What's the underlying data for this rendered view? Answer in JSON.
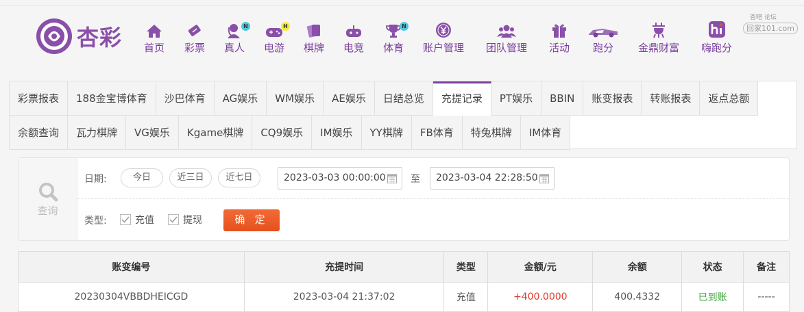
{
  "brand": {
    "name": "杏彩",
    "accent": "#7b3f9e"
  },
  "nav": [
    {
      "label": "首页",
      "icon": "home-icon"
    },
    {
      "label": "彩票",
      "icon": "lottery-ticket-icon"
    },
    {
      "label": "真人",
      "icon": "live-dealer-icon",
      "badge": "N"
    },
    {
      "label": "电游",
      "icon": "gamepad-icon",
      "badge": "H"
    },
    {
      "label": "棋牌",
      "icon": "cards-icon"
    },
    {
      "label": "电竞",
      "icon": "joystick-icon"
    },
    {
      "label": "体育",
      "icon": "trophy-icon",
      "badge": "N"
    },
    {
      "label": "账户管理",
      "icon": "yen-coin-icon"
    },
    {
      "label": "团队管理",
      "icon": "team-icon"
    },
    {
      "label": "活动",
      "icon": "gift-icon"
    },
    {
      "label": "跑分",
      "icon": "race-car-icon"
    },
    {
      "label": "金鼎财富",
      "icon": "ding-cauldron-icon"
    },
    {
      "label": "嗨跑分",
      "icon": "hi-app-icon"
    }
  ],
  "watermark": {
    "top": "杏吧 论坛",
    "bottom": "回家101.com"
  },
  "tabs": {
    "row1": [
      "彩票报表",
      "188金宝博体育",
      "沙巴体育",
      "AG娱乐",
      "WM娱乐",
      "AE娱乐",
      "日结总览",
      "充提记录",
      "PT娱乐",
      "BBIN",
      "账变报表",
      "转账报表",
      "返点总额"
    ],
    "row2": [
      "余额查询",
      "瓦力棋牌",
      "VG娱乐",
      "Kgame棋牌",
      "CQ9娱乐",
      "IM娱乐",
      "YY棋牌",
      "FB体育",
      "特兔棋牌",
      "IM体育"
    ],
    "active": "充提记录"
  },
  "query": {
    "side_label": "查询",
    "date_label": "日期:",
    "quick": [
      "今日",
      "近三日",
      "近七日"
    ],
    "start": "2023-03-03 00:00:00",
    "to": "至",
    "end": "2023-03-04 22:28:50",
    "type_label": "类型:",
    "types": [
      "充值",
      "提现"
    ],
    "confirm": "确 定"
  },
  "table": {
    "headers": [
      "账变编号",
      "充提时间",
      "类型",
      "金额/元",
      "余额",
      "状态",
      "备注"
    ],
    "rows": [
      [
        "20230304VBBDHEICGD",
        "2023-03-04 21:37:02",
        "充值",
        "+400.0000",
        "400.4332",
        "已到账",
        "-----"
      ]
    ]
  }
}
